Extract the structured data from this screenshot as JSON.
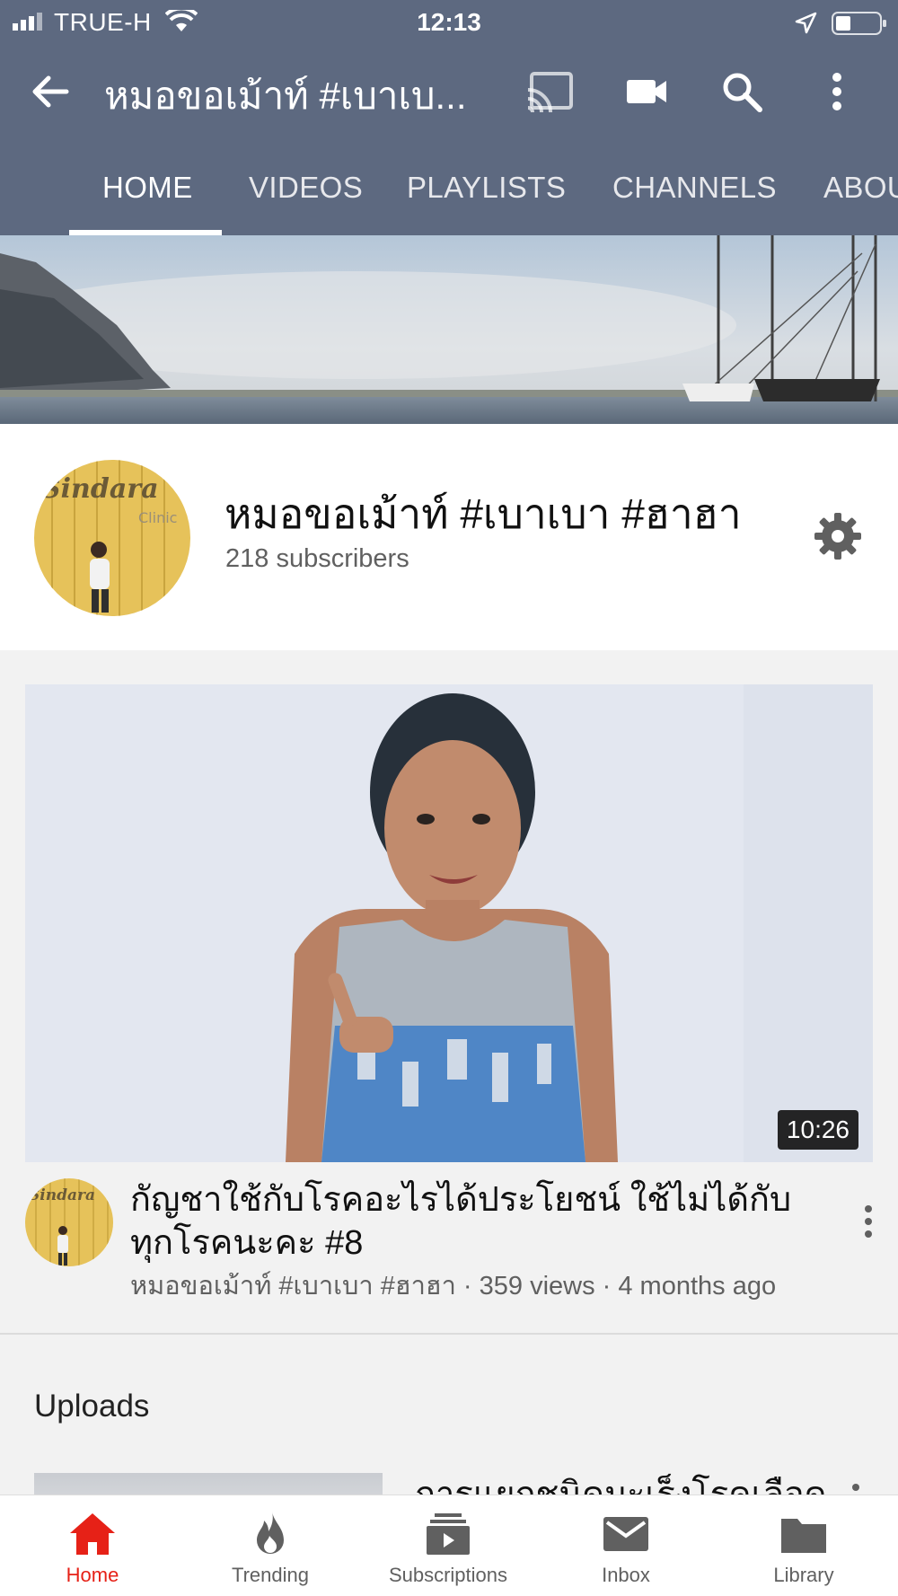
{
  "status_bar": {
    "carrier": "TRUE-H",
    "time": "12:13"
  },
  "app_bar": {
    "title": "หมอขอเม้าท์ #เบาเบ..."
  },
  "tabs": [
    {
      "label": "HOME",
      "active": true
    },
    {
      "label": "VIDEOS",
      "active": false
    },
    {
      "label": "PLAYLISTS",
      "active": false
    },
    {
      "label": "CHANNELS",
      "active": false
    },
    {
      "label": "ABOU",
      "active": false
    }
  ],
  "channel": {
    "name": "หมอขอเม้าท์ #เบาเบา #ฮาฮา",
    "subscribers": "218 subscribers",
    "avatar_sign_text": "Sindara",
    "avatar_sign_text2": "Clinic"
  },
  "featured_video": {
    "duration": "10:26",
    "title": "กัญชาใช้กับโรคอะไรได้ประโยชน์ ใช้ไม่ได้กับทุกโรคนะคะ #8",
    "meta": "หมอขอเม้าท์ #เบาเบา #ฮาฮา · 359 views · 4 months ago"
  },
  "uploads": {
    "heading": "Uploads",
    "first_item_title": "การแยกชนิดมะเร็งโรคเลือด"
  },
  "bottom_nav": [
    {
      "label": "Home",
      "icon": "home-icon",
      "active": true
    },
    {
      "label": "Trending",
      "icon": "flame-icon",
      "active": false
    },
    {
      "label": "Subscriptions",
      "icon": "subscriptions-icon",
      "active": false
    },
    {
      "label": "Inbox",
      "icon": "mail-icon",
      "active": false
    },
    {
      "label": "Library",
      "icon": "folder-icon",
      "active": false
    }
  ],
  "colors": {
    "header_bg": "#5d6980",
    "active_red": "#e62117",
    "feed_bg": "#f2f2f2"
  }
}
